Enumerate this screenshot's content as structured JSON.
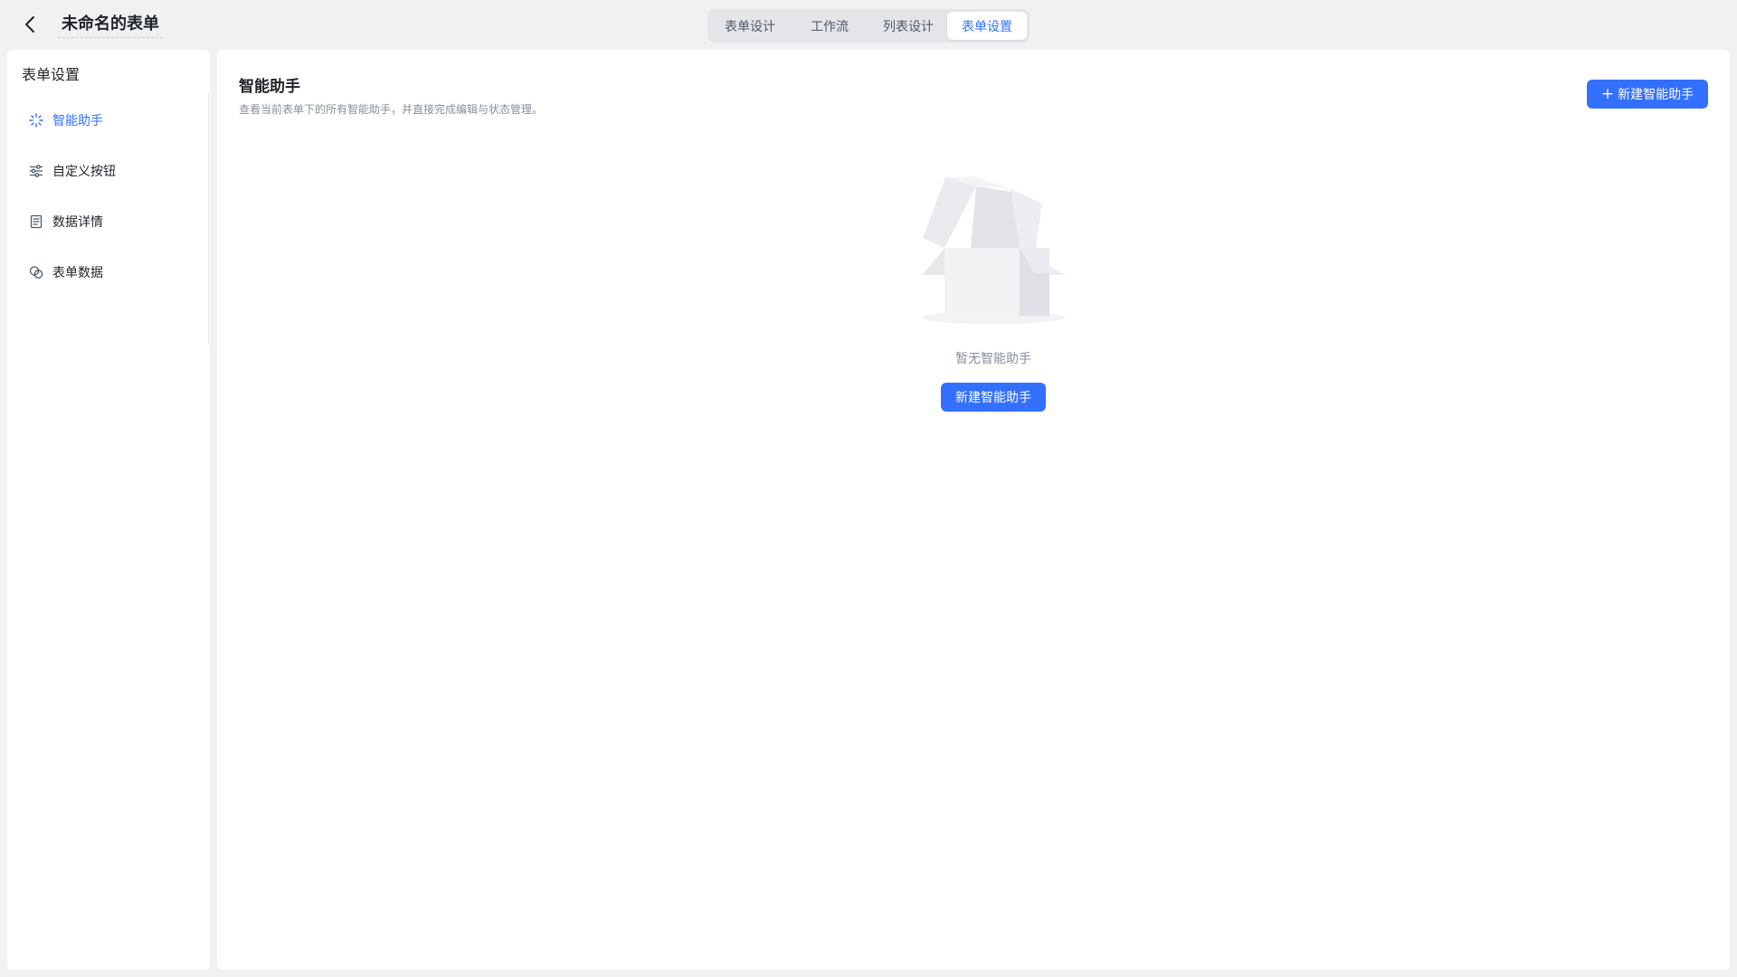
{
  "header": {
    "form_title": "未命名的表单",
    "tabs": [
      {
        "label": "表单设计"
      },
      {
        "label": "工作流"
      },
      {
        "label": "列表设计"
      },
      {
        "label": "表单设置"
      }
    ],
    "active_tab": "表单设置"
  },
  "sidebar": {
    "title": "表单设置",
    "items": [
      {
        "label": "智能助手",
        "icon": "sparkle-icon",
        "active": true
      },
      {
        "label": "自定义按钮",
        "icon": "sliders-icon",
        "active": false
      },
      {
        "label": "数据详情",
        "icon": "document-icon",
        "active": false
      },
      {
        "label": "表单数据",
        "icon": "data-link-icon",
        "active": false
      }
    ]
  },
  "main": {
    "title": "智能助手",
    "description": "查看当前表单下的所有智能助手，并直接完成编辑与状态管理。",
    "add_button_label": "新建智能助手",
    "empty_text": "暂无智能助手",
    "empty_button_label": "新建智能助手"
  },
  "colors": {
    "accent": "#3370ff",
    "page_bg": "#f0f1f3",
    "panel_bg": "#ffffff",
    "muted_text": "#86909c"
  }
}
